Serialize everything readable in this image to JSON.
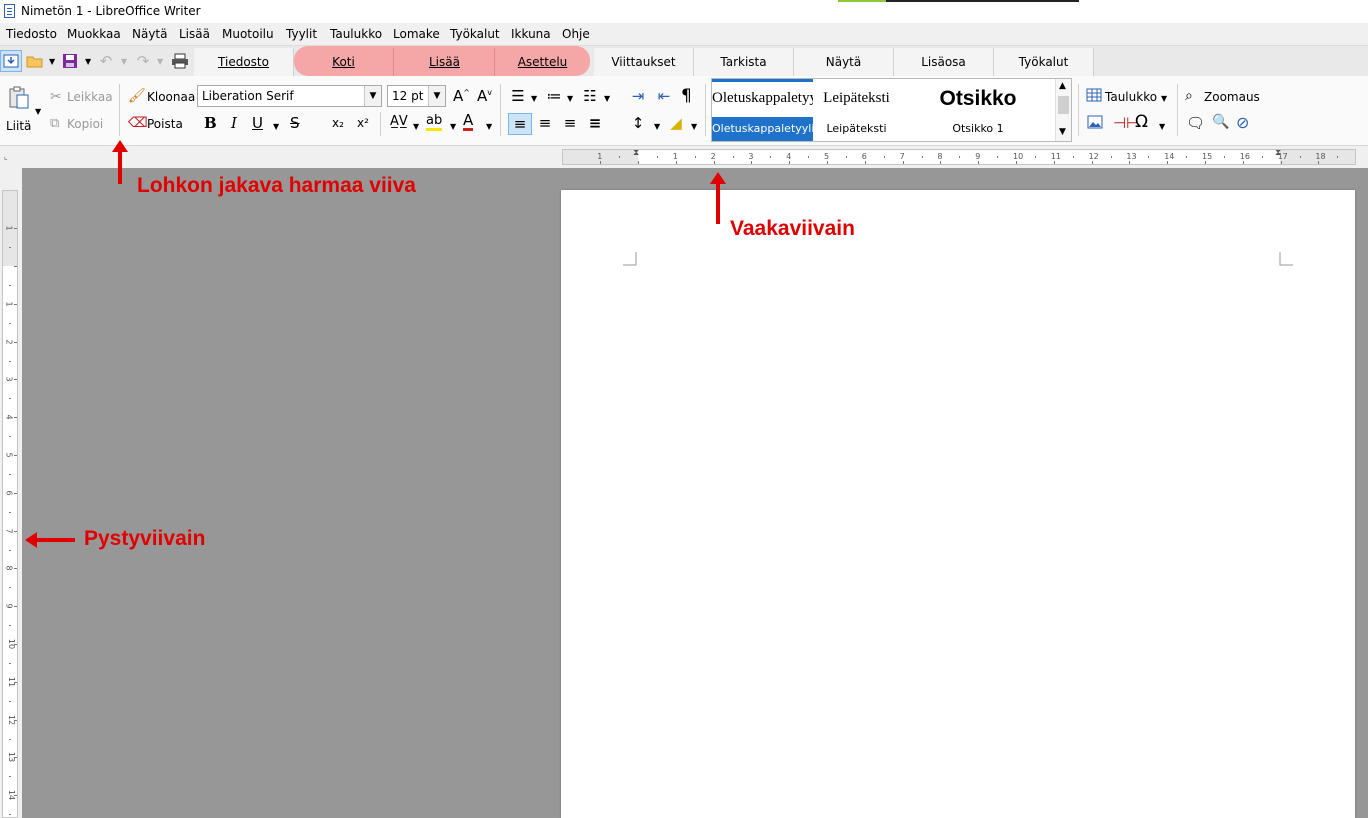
{
  "window": {
    "title": "Nimetön 1 - LibreOffice Writer"
  },
  "menubar": {
    "items": [
      "Tiedosto",
      "Muokkaa",
      "Näytä",
      "Lisää",
      "Muotoilu",
      "Tyylit",
      "Taulukko",
      "Lomake",
      "Työkalut",
      "Ikkuna",
      "Ohje"
    ]
  },
  "tabs": [
    {
      "label": "Tiedosto"
    },
    {
      "label": "Koti"
    },
    {
      "label": "Lisää"
    },
    {
      "label": "Asettelu"
    },
    {
      "label": "Viittaukset"
    },
    {
      "label": "Tarkista"
    },
    {
      "label": "Näytä"
    },
    {
      "label": "Lisäosa"
    },
    {
      "label": "Työkalut"
    }
  ],
  "ribbon": {
    "paste_label": "Liitä",
    "cut_label": "Leikkaa",
    "copy_label": "Kopioi",
    "clone_label": "Kloonaa",
    "clear_label": "Poista",
    "font_name": "Liberation Serif",
    "font_size": "12 pt",
    "bold": "B",
    "italic": "I",
    "underline": "U",
    "strike": "S",
    "subscript": "x₂",
    "superscript": "x²",
    "pilcrow": "¶",
    "styles": [
      {
        "preview": "Oletuskappaletyyli",
        "name": "Oletuskappaletyyli",
        "selected": true
      },
      {
        "preview": "Leipäteksti",
        "name": "Leipäteksti",
        "selected": false
      },
      {
        "preview": "Otsikko",
        "name": "Otsikko 1",
        "selected": false
      }
    ],
    "table_label": "Taulukko",
    "zoom_label": "Zoomaus"
  },
  "hruler": {
    "labels": [
      "1",
      "1",
      "2",
      "3",
      "4",
      "5",
      "6",
      "7",
      "8",
      "9",
      "10",
      "11",
      "12",
      "13",
      "14",
      "15",
      "16",
      "17",
      "18"
    ]
  },
  "vruler": {
    "labels": [
      "1",
      "1",
      "2",
      "3",
      "4",
      "5",
      "6",
      "7",
      "8",
      "9",
      "10",
      "11",
      "12",
      "13",
      "14"
    ]
  },
  "annotations": {
    "divider_label": "Lohkon jakava harmaa viiva",
    "hruler_label": "Vaakaviivain",
    "vruler_label": "Pystyviivain"
  },
  "colors": {
    "annotation": "#e00000",
    "tab_highlight": "#f5a7a8",
    "selected_style": "#1e72c9",
    "workspace": "#979797"
  }
}
